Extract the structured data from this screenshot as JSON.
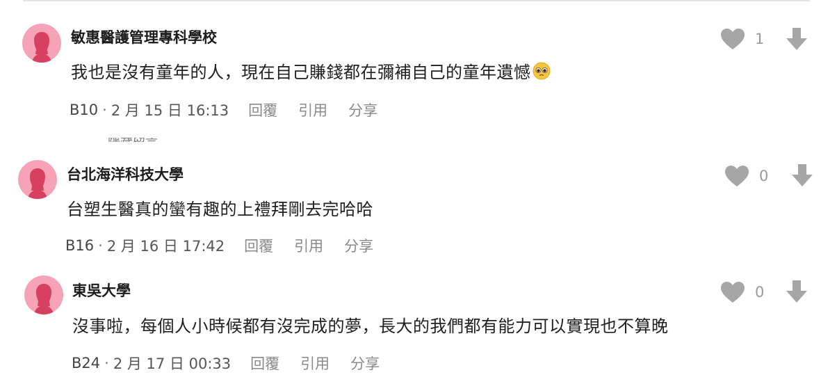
{
  "comments": [
    {
      "author": "敏惠醫護管理專科學校",
      "text": "我也是沒有童年的人，現在自己賺錢都在彌補自己的童年遺憾",
      "emoji": "pleading-face-emoji",
      "floor": "B10",
      "date": "2 月 15 日 16:13",
      "likes": "1",
      "actions": {
        "reply": "回覆",
        "quote": "引用",
        "share": "分享"
      }
    },
    {
      "author": "台北海洋科技大學",
      "text": "台塑生醫真的蠻有趣的上禮拜剛去完哈哈",
      "floor": "B16",
      "date": "2 月 16 日 17:42",
      "likes": "0",
      "actions": {
        "reply": "回覆",
        "quote": "引用",
        "share": "分享"
      }
    },
    {
      "author": "東吳大學",
      "text": "沒事啦，每個人小時候都有沒完成的夢，長大的我們都有能力可以實現也不算晚",
      "floor": "B24",
      "date": "2 月 17 日 00:33",
      "likes": "0",
      "actions": {
        "reply": "回覆",
        "quote": "引用",
        "share": "分享"
      }
    }
  ],
  "ghost_text": "隱藏留言",
  "colors": {
    "avatar_bg": "#f6a3b8",
    "avatar_figure": "#d8405f",
    "icon_gray": "#a6a6a6",
    "action_gray": "#8a8a8a"
  },
  "icons": {
    "like": "heart-icon",
    "down": "arrow-down-icon",
    "avatar": "female-avatar-icon"
  },
  "separator": "·"
}
